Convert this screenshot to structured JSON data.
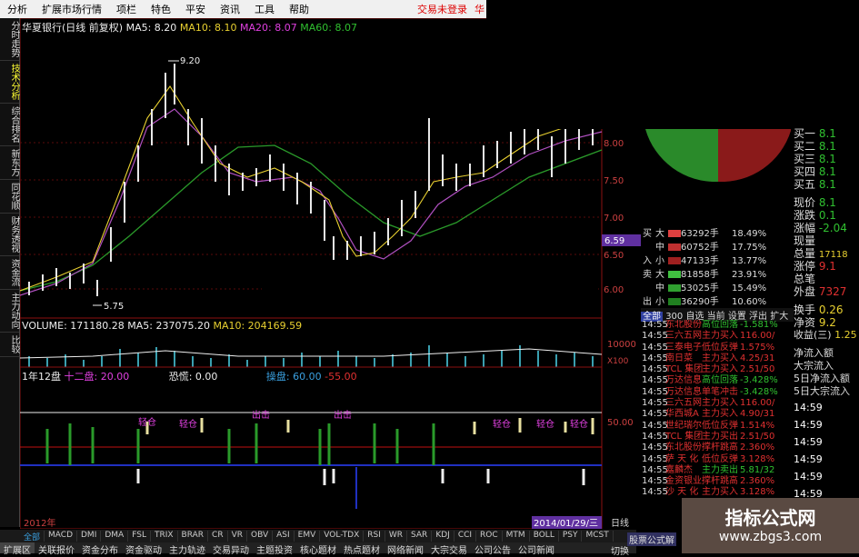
{
  "menu": {
    "items": [
      "分析",
      "扩展市场行情",
      "项栏",
      "特色",
      "平安",
      "资讯",
      "工具",
      "帮助"
    ],
    "warning": "交易未登录",
    "extra": "华"
  },
  "left_tabs": [
    "分时走势",
    "技术分析",
    "综合排名",
    "新东方",
    "同花顺",
    "财务透视",
    "资金流",
    "主力动向",
    "比较"
  ],
  "chart": {
    "title": "华夏银行(日线 前复权)",
    "ma5": "MA5: 8.20",
    "ma10": "MA10: 8.10",
    "ma20": "MA20: 8.07",
    "ma60": "MA60: 8.07",
    "high_label": "9.20",
    "low_label": "5.75",
    "y_ticks": [
      "8.00",
      "7.50",
      "7.00",
      "6.50",
      "6.00"
    ],
    "price_tag": "6.59",
    "vol_header": "VOLUME: 171180.28",
    "vol_ma5": "MA5: 237075.20",
    "vol_ma10": "MA10: 204169.59",
    "vol_tick": "10000",
    "vol_unit": "X100",
    "ind_header": "1年12盘",
    "ind_a": "十二盘: 20.00",
    "ind_b": "恐慌: 0.00",
    "ind_c": "操盘: 60.00",
    "ind_d": "-55.00",
    "ind_tick": "50.00",
    "ind_labels": [
      "轻仓",
      "轻仓",
      "出击",
      "出击",
      "轻仓",
      "轻仓",
      "轻仓"
    ],
    "date_label": "2014/01/29/三",
    "year_label": "2012年"
  },
  "orderbook": {
    "buy": [
      "买一",
      "买二",
      "买三",
      "买四",
      "买五"
    ],
    "buy_vals": [
      "8.1",
      "8.1",
      "8.1",
      "8.1",
      "8.1"
    ],
    "stats": [
      [
        "现价",
        "8.1"
      ],
      [
        "涨跌",
        "0.1"
      ],
      [
        "涨幅",
        "-2.04"
      ],
      [
        "现量",
        ""
      ],
      [
        "总量",
        "17118"
      ],
      [
        "涨停",
        "9.1"
      ],
      [
        "总笔",
        ""
      ],
      [
        "外盘",
        "7327"
      ],
      [
        "换手",
        "0.26"
      ],
      [
        "净资",
        "9.2"
      ],
      [
        "收益(三)",
        "1.25"
      ]
    ],
    "flow": [
      "净流入额",
      "大宗流入",
      "5日净流入额",
      "5日大宗流入"
    ]
  },
  "dist": {
    "rows": [
      [
        "买",
        "大",
        "63292手",
        "18.49%"
      ],
      [
        "",
        "中",
        "60752手",
        "17.75%"
      ],
      [
        "入",
        "小",
        "47133手",
        "13.77%"
      ],
      [
        "卖",
        "大",
        "81858手",
        "23.91%"
      ],
      [
        "",
        "中",
        "53025手",
        "15.49%"
      ],
      [
        "出",
        "小",
        "36290手",
        "10.60%"
      ]
    ]
  },
  "subtabs": [
    "全部",
    "300",
    "自选",
    "当前",
    "设置",
    "浮出",
    "扩大"
  ],
  "ticker": [
    [
      "14:55",
      "东北股份",
      "高位回落",
      "-1.581%"
    ],
    [
      "14:55",
      "三六五网",
      "主力买入",
      "116.00/"
    ],
    [
      "14:55",
      "三泰电子",
      "低位反弹",
      "1.575%"
    ],
    [
      "14:55",
      "南日菜",
      "主力买入",
      "4.25/31"
    ],
    [
      "14:55",
      "TCL 集团",
      "主力买入",
      "2.51/50"
    ],
    [
      "14:55",
      "万达信息",
      "高位回落",
      "-3.428%"
    ],
    [
      "14:55",
      "万达信息",
      "单笔冲击",
      "-3.428%"
    ],
    [
      "14:55",
      "三六五网",
      "主力买入",
      "116.00/"
    ],
    [
      "14:55",
      "华西城A",
      "主力买入",
      "4.90/31"
    ],
    [
      "14:55",
      "世纪瑞尔",
      "低位反弹",
      "1.514%"
    ],
    [
      "14:55",
      "TCL 集团",
      "主力买出",
      "2.51/50"
    ],
    [
      "14:55",
      "东北股份",
      "撑杆跳高",
      "2.360%"
    ],
    [
      "14:55",
      "萨 天 化",
      "低位反弹",
      "3.128%"
    ],
    [
      "14:55",
      "嘉麟杰",
      "主力卖出",
      "5.81/32"
    ],
    [
      "14:55",
      "金资银业",
      "撑杆跳高",
      "2.360%"
    ],
    [
      "14:55",
      "沙 天 化",
      "主力买入",
      "3.128%"
    ]
  ],
  "times": [
    "14:59",
    "14:59",
    "14:59",
    "14:59",
    "14:59",
    "14:59"
  ],
  "tabs_row1": [
    "全部",
    "MACD",
    "DMI",
    "DMA",
    "FSL",
    "TRIX",
    "BRAR",
    "CR",
    "VR",
    "OBV",
    "ASI",
    "EMV",
    "VOL-TDX",
    "RSI",
    "WR",
    "SAR",
    "KDJ",
    "CCI",
    "ROC",
    "MTM",
    "BOLL",
    "PSY",
    "MCST"
  ],
  "tabs_row2": [
    "扩展区",
    "关联报价",
    "资金分布",
    "资金驱动",
    "主力轨迹",
    "交易异动",
    "主题投资",
    "核心题材",
    "热点题材",
    "网络新闻",
    "大宗交易",
    "公司公告",
    "公司新闻"
  ],
  "daily_label": "日线",
  "formula_label": "股票公式解",
  "switch_label": "切换",
  "watermark": {
    "title": "指标公式网",
    "url": "www.zbgs3.com"
  }
}
